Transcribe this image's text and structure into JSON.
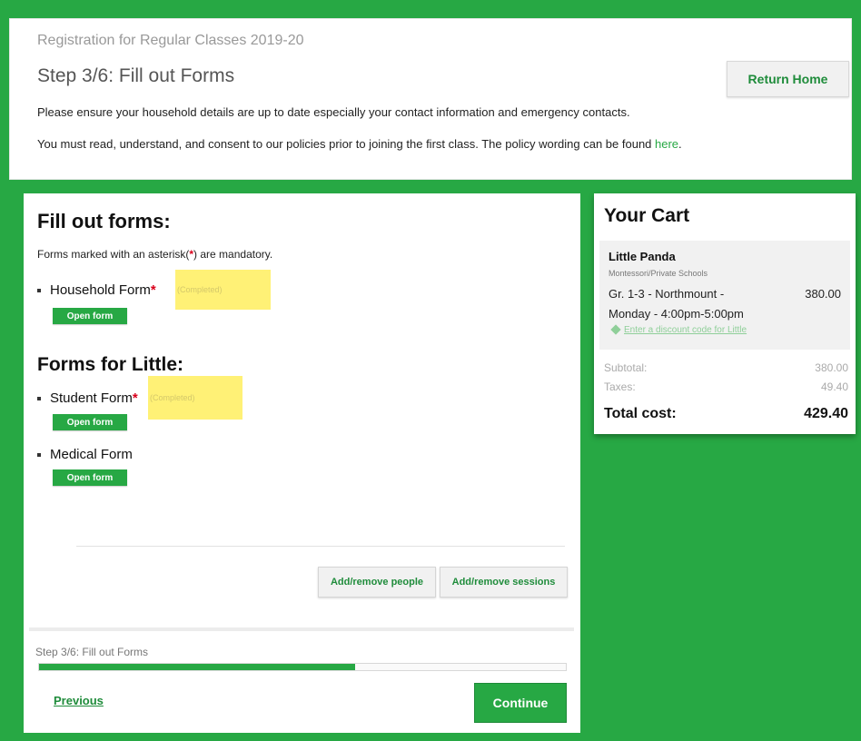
{
  "header": {
    "breadcrumb": "Registration for Regular Classes 2019-20",
    "step_title": "Step 3/6: Fill out Forms",
    "return_home_label": "Return Home",
    "info_line_1": "Please ensure your household details are up to date especially your contact information and emergency contacts.",
    "info_line_2_prefix": "You must read, understand, and consent to our policies prior to joining the first class. The policy wording can be found ",
    "info_line_2_link": "here",
    "info_line_2_suffix": "."
  },
  "forms": {
    "heading": "Fill out forms:",
    "mandatory_prefix": "Forms marked with an asterisk(",
    "mandatory_star": "*",
    "mandatory_suffix": ") are mandatory.",
    "household": {
      "label": "Household Form",
      "star": "*",
      "status": "(Completed)",
      "button": "Open form"
    },
    "student_section_heading": "Forms for Little:",
    "student": {
      "label": "Student Form",
      "star": "*",
      "status": "(Completed)",
      "button": "Open form"
    },
    "medical": {
      "label": "Medical Form",
      "button": "Open form"
    }
  },
  "actions": {
    "add_remove_people": "Add/remove people",
    "add_remove_sessions": "Add/remove sessions"
  },
  "progress": {
    "label": "Step 3/6: Fill out Forms",
    "fraction": 0.6,
    "previous_label": "Previous",
    "continue_label": "Continue"
  },
  "cart": {
    "title": "Your Cart",
    "student_name": "Little Panda",
    "organization": "Montessori/Private Schools",
    "class_line_1": "Gr. 1-3 - Northmount -",
    "class_line_2": "Monday - 4:00pm-5:00pm",
    "price": "380.00",
    "discount_link": "Enter a discount code for Little",
    "subtotal_label": "Subtotal:",
    "subtotal_value": "380.00",
    "taxes_label": "Taxes:",
    "taxes_value": "49.40",
    "total_label": "Total cost:",
    "total_value": "429.40"
  },
  "colors": {
    "brand_green": "#27a844",
    "highlight_yellow": "#fff176",
    "required_red": "#d9001b"
  }
}
